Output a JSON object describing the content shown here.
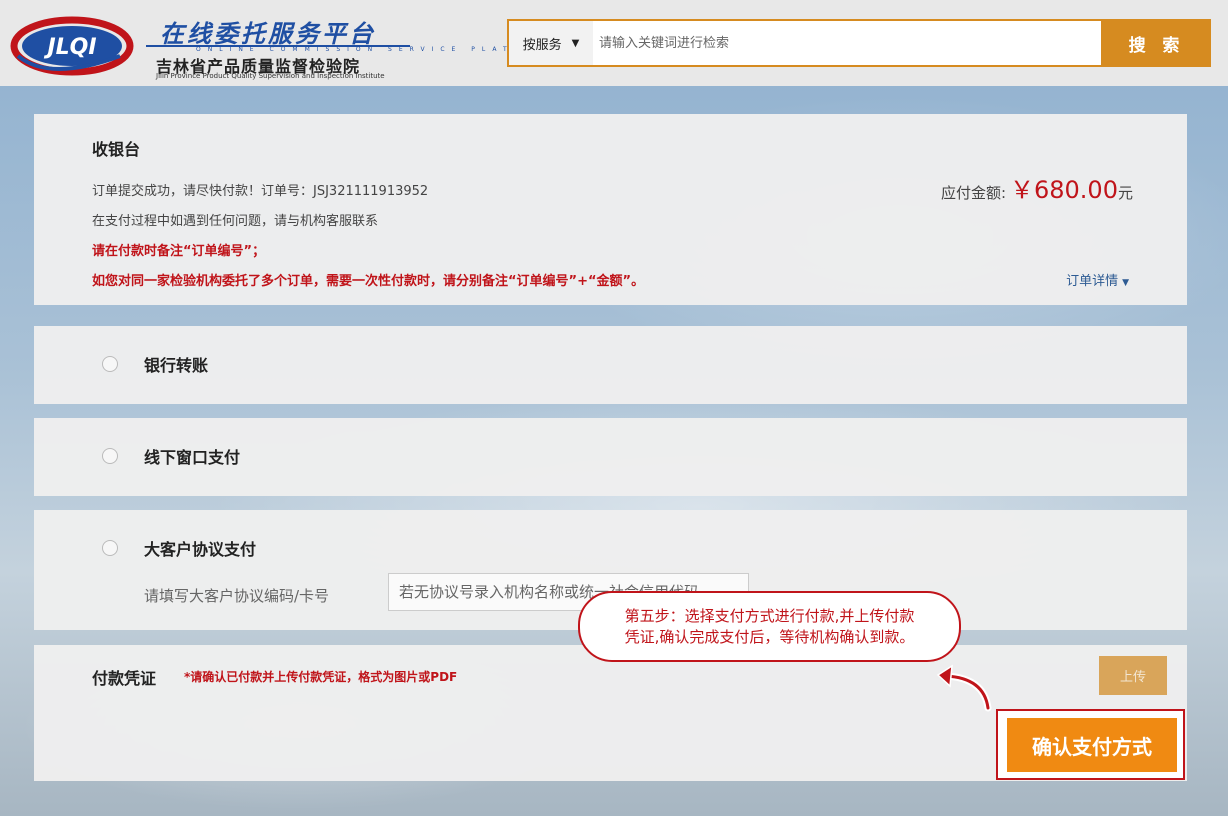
{
  "header": {
    "logo": {
      "badge_text": "JLQI",
      "title": "在线委托服务平台",
      "subtitle_en": "ONLINE COMMISSION SERVICE PLATFORM",
      "org_name": "吉林省产品质量监督检验院",
      "org_name_en": "Jilin Province Product Quality Supervision and Inspection Institute"
    },
    "search": {
      "scope": "按服务",
      "placeholder": "请输入关键词进行检索",
      "button_label": "搜 索"
    }
  },
  "cashier": {
    "title": "收银台",
    "order_prefix": "订单提交成功，请尽快付款！订单号：",
    "order_number": "JSJ321111913952",
    "help_text": "在支付过程中如遇到任何问题，请与机构客服联系",
    "note_1": "请在付款时备注“订单编号”；",
    "note_2": "如您对同一家检验机构委托了多个订单，需要一次性付款时，请分别备注“订单编号”+“金额”。",
    "amount_label": "应付金额:",
    "amount_value": "￥680.00",
    "amount_unit": "元",
    "order_detail_label": "订单详情"
  },
  "payment_options": {
    "bank": {
      "label": "银行转账"
    },
    "window": {
      "label": "线下窗口支付"
    },
    "vip": {
      "label": "大客户协议支付",
      "field_label": "请填写大客户协议编码/卡号",
      "field_placeholder": "若无协议号录入机构名称或统一社会信用代码"
    }
  },
  "voucher": {
    "title": "付款凭证",
    "note": "*请确认已付款并上传付款凭证，格式为图片或PDF",
    "upload_label": "上传"
  },
  "tutorial": {
    "callout_line1": "第五步：选择支付方式进行付款,并上传付款",
    "callout_line2": "凭证,确认完成支付后，等待机构确认到款。",
    "confirm_label": "确认支付方式"
  },
  "colors": {
    "accent": "#d68b20",
    "confirm": "#f08a12",
    "alert": "#c0141a",
    "link": "#2d5b93"
  }
}
